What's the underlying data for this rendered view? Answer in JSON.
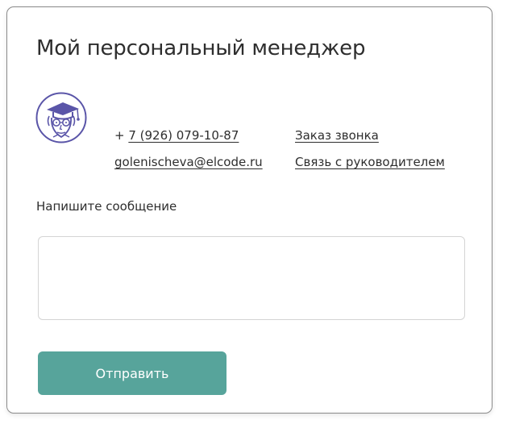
{
  "manager": {
    "title": "Мой персональный менеджер",
    "avatar_icon": "manager-avatar-icon",
    "phone_prefix": "+ ",
    "phone": "7 (926) 079-10-87",
    "email": "golenischeva@elcode.ru",
    "callback_label": "Заказ звонка",
    "contact_head_label": "Связь с руководителем"
  },
  "message": {
    "label": "Напишите сообщение",
    "value": "",
    "placeholder": ""
  },
  "send_button": {
    "label": "Отправить"
  },
  "colors": {
    "accent": "#57a49b",
    "avatar_stroke": "#5a55a8",
    "text": "#2e2e2e",
    "card_border": "#8a8a8a"
  }
}
